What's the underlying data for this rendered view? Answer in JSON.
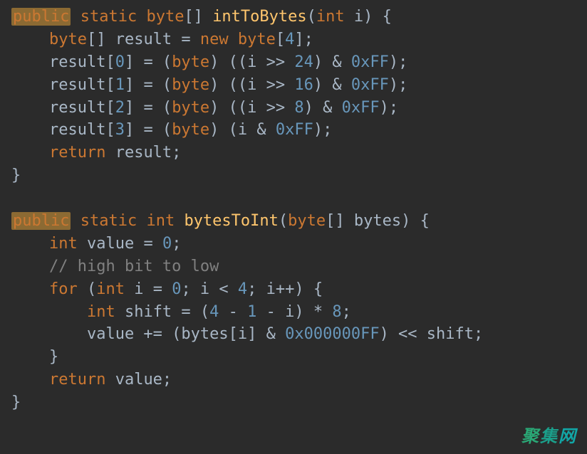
{
  "code": {
    "line1": {
      "public": "public",
      "static": " static ",
      "byte_arr": "byte",
      "brackets": "[] ",
      "fn": "intToBytes",
      "paren_open": "(",
      "int": "int ",
      "param": "i",
      "paren_close": ") {"
    },
    "line2": {
      "indent": "    ",
      "byte": "byte",
      "brackets": "[] result = ",
      "new": "new ",
      "byte2": "byte",
      "open": "[",
      "num": "4",
      "close": "];"
    },
    "line3": {
      "indent": "    result[",
      "idx": "0",
      "mid": "] = (",
      "byte": "byte",
      "after": ") ((i >> ",
      "shift": "24",
      "and": ") & ",
      "mask": "0xFF",
      "end": ");"
    },
    "line4": {
      "indent": "    result[",
      "idx": "1",
      "mid": "] = (",
      "byte": "byte",
      "after": ") ((i >> ",
      "shift": "16",
      "and": ") & ",
      "mask": "0xFF",
      "end": ");"
    },
    "line5": {
      "indent": "    result[",
      "idx": "2",
      "mid": "] = (",
      "byte": "byte",
      "after": ") ((i >> ",
      "shift": "8",
      "and": ") & ",
      "mask": "0xFF",
      "end": ");"
    },
    "line6": {
      "indent": "    result[",
      "idx": "3",
      "mid": "] = (",
      "byte": "byte",
      "after": ") (i & ",
      "mask": "0xFF",
      "end": ");"
    },
    "line7": {
      "indent": "    ",
      "return": "return ",
      "var": "result;"
    },
    "line8": {
      "brace": "}"
    },
    "line10": {
      "public": "public",
      "static": " static ",
      "int": "int ",
      "fn": "bytesToInt",
      "paren_open": "(",
      "byte": "byte",
      "brackets": "[] bytes",
      "paren_close": ") {"
    },
    "line11": {
      "indent": "    ",
      "int": "int ",
      "rest": "value = ",
      "num": "0",
      "semi": ";"
    },
    "line12": {
      "indent": "    ",
      "comment": "// high bit to low"
    },
    "line13": {
      "indent": "    ",
      "for": "for ",
      "open": "(",
      "int": "int ",
      "init": "i = ",
      "zero": "0",
      "cond": "; i < ",
      "four": "4",
      "inc": "; i++) {"
    },
    "line14": {
      "indent": "        ",
      "int": "int ",
      "rest": "shift = (",
      "four": "4",
      "minus": " - ",
      "one": "1",
      "minus2": " - i) * ",
      "eight": "8",
      "semi": ";"
    },
    "line15": {
      "indent": "        value += (bytes[i] & ",
      "mask": "0x000000FF",
      "rest": ") << shift;"
    },
    "line16": {
      "indent": "    }"
    },
    "line17": {
      "indent": "    ",
      "return": "return ",
      "var": "value;"
    },
    "line18": {
      "brace": "}"
    }
  },
  "watermark": {
    "char1": "聚",
    "char2": "集",
    "char3": "网"
  }
}
